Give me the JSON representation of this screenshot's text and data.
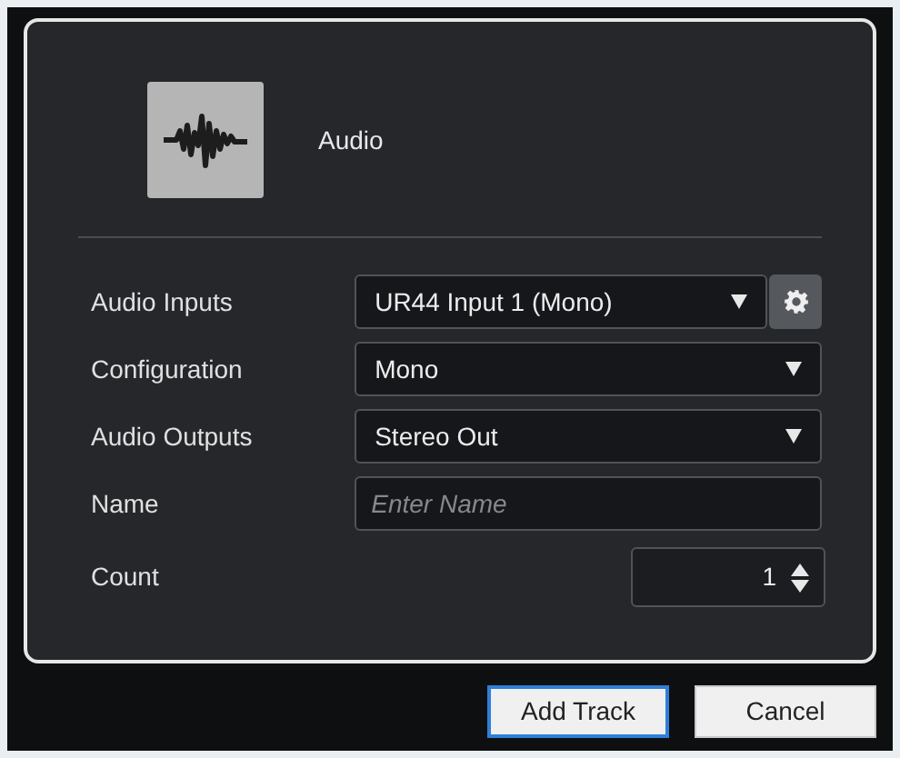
{
  "header": {
    "track_type": "Audio"
  },
  "fields": [
    {
      "kind": "dropdown",
      "label": "Audio Inputs",
      "value": "UR44 Input 1 (Mono)",
      "settings": true
    },
    {
      "kind": "dropdown",
      "label": "Configuration",
      "value": "Mono",
      "settings": false
    },
    {
      "kind": "dropdown",
      "label": "Audio Outputs",
      "value": "Stereo Out",
      "settings": false
    },
    {
      "kind": "text",
      "label": "Name",
      "placeholder": "Enter Name"
    },
    {
      "kind": "spinner",
      "label": "Count",
      "value": "1"
    }
  ],
  "buttons": [
    {
      "label": "Add Track",
      "default": true
    },
    {
      "label": "Cancel",
      "default": false
    }
  ]
}
